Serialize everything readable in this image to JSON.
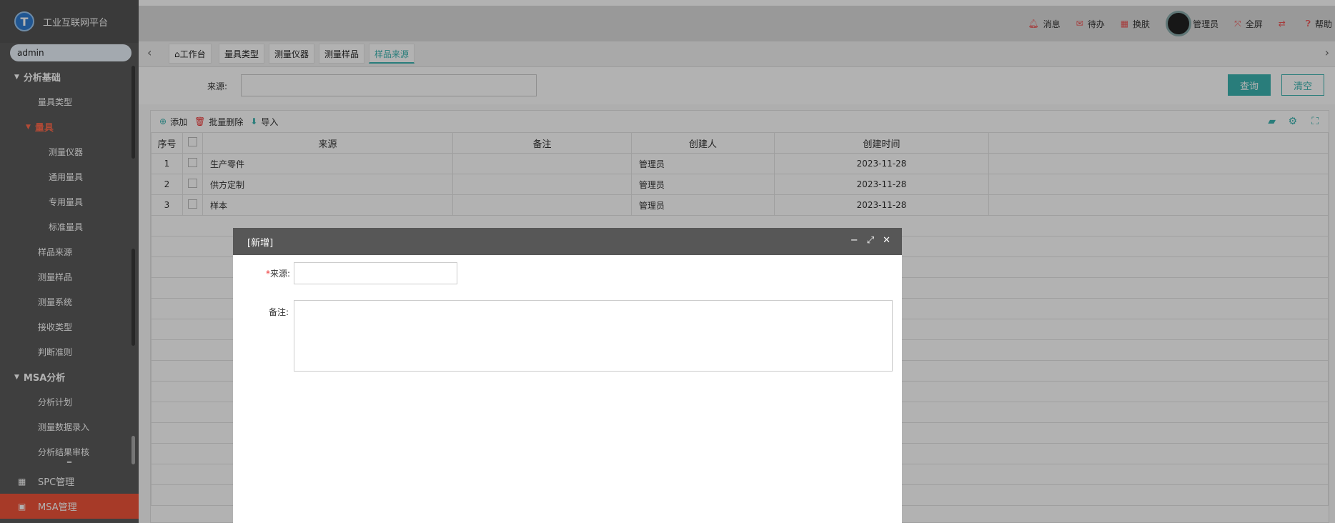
{
  "app": {
    "title": "工业互联网平台",
    "logo_letter": "T"
  },
  "sidebar": {
    "search_value": "admin",
    "menu": [
      {
        "label": "分析基础",
        "level": "group"
      },
      {
        "label": "量具类型",
        "level": "l1"
      },
      {
        "label": "量具",
        "level": "l1g"
      },
      {
        "label": "测量仪器",
        "level": "l2"
      },
      {
        "label": "通用量具",
        "level": "l2"
      },
      {
        "label": "专用量具",
        "level": "l2"
      },
      {
        "label": "标准量具",
        "level": "l2"
      },
      {
        "label": "样品来源",
        "level": "l1"
      },
      {
        "label": "测量样品",
        "level": "l1"
      },
      {
        "label": "测量系统",
        "level": "l1"
      },
      {
        "label": "接收类型",
        "level": "l1"
      },
      {
        "label": "判断准则",
        "level": "l1"
      },
      {
        "label": "MSA分析",
        "level": "group"
      },
      {
        "label": "分析计划",
        "level": "l1"
      },
      {
        "label": "测量数据录入",
        "level": "l1"
      },
      {
        "label": "分析结果审核",
        "level": "l1"
      }
    ],
    "bottom": [
      {
        "label": "SPC管理",
        "active": false
      },
      {
        "label": "MSA管理",
        "active": true
      }
    ]
  },
  "topbar": {
    "items": [
      "消息",
      "待办",
      "换肤"
    ],
    "user": "管理员",
    "fullscreen": "全屏",
    "help": "帮助"
  },
  "tabs": [
    {
      "label": "工作台",
      "active": false
    },
    {
      "label": "量具类型",
      "active": false
    },
    {
      "label": "测量仪器",
      "active": false
    },
    {
      "label": "测量样品",
      "active": false
    },
    {
      "label": "样品来源",
      "active": true
    }
  ],
  "filter": {
    "label": "来源:",
    "value": ""
  },
  "buttons": {
    "query": "查询",
    "clear": "清空"
  },
  "toolbar": {
    "add": "添加",
    "batch_delete": "批量删除",
    "import": "导入"
  },
  "table": {
    "headers": [
      "序号",
      "来源",
      "备注",
      "创建人",
      "创建时间"
    ],
    "rows": [
      [
        "1",
        "生产零件",
        "",
        "管理员",
        "2023-11-28"
      ],
      [
        "2",
        "供方定制",
        "",
        "管理员",
        "2023-11-28"
      ],
      [
        "3",
        "样本",
        "",
        "管理员",
        "2023-11-28"
      ]
    ]
  },
  "dialog": {
    "title": "[新增]",
    "required_mark": "*",
    "field_source_label": "来源:",
    "field_source_value": "",
    "field_remark_label": "备注:",
    "field_remark_value": ""
  },
  "colors": {
    "accent": "#3bb3b0",
    "active_menu": "#f0543a",
    "sidebar": "#5b5b5b"
  }
}
